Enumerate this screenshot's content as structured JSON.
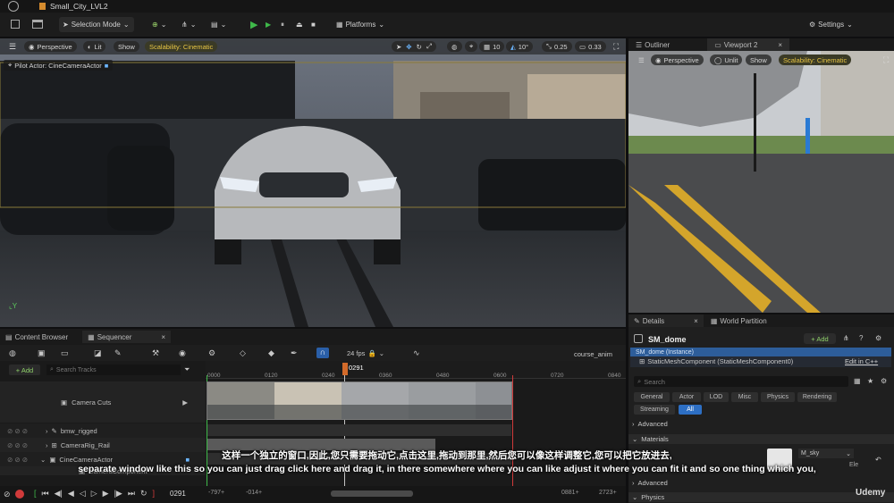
{
  "window": {
    "title": "Small_City_LVL2"
  },
  "toolbar": {
    "selection_mode": "Selection Mode",
    "platforms": "Platforms",
    "settings": "Settings"
  },
  "viewport_left": {
    "perspective": "Perspective",
    "lit": "Lit",
    "show": "Show",
    "scalability": "Scalability: Cinematic",
    "pilot": "Pilot Actor: CineCameraActor",
    "grid_snap": "10",
    "angle_snap": "10°",
    "scale_snap": "0.25",
    "cam_speed": "0.33"
  },
  "right_tabs": {
    "outliner": "Outliner",
    "viewport2": "Viewport 2"
  },
  "viewport_right": {
    "perspective": "Perspective",
    "unlit": "Unlit",
    "show": "Show",
    "scalability": "Scalability: Cinematic"
  },
  "details": {
    "tab": "Details",
    "world_partition": "World Partition",
    "object": "SM_dome",
    "add": "+ Add",
    "instance": "SM_dome (Instance)",
    "component": "StaticMeshComponent (StaticMeshComponent0)",
    "edit_cpp": "Edit in C++",
    "search": "Search",
    "filters": [
      "General",
      "Actor",
      "LOD",
      "Misc",
      "Physics",
      "Rendering",
      "Streaming",
      "All"
    ],
    "sections": [
      "Advanced",
      "Materials",
      "Advanced",
      "Physics"
    ],
    "material": "M_sky",
    "element": "Ele"
  },
  "bottom_tabs": {
    "content_browser": "Content Browser",
    "sequencer": "Sequencer"
  },
  "sequencer": {
    "fps": "24 fps",
    "add": "+ Add",
    "search": "Search Tracks",
    "name": "course_anim",
    "playhead": "0291",
    "ruler": [
      "0000",
      "0120",
      "0240",
      "0360",
      "0480",
      "0600",
      "0720",
      "0840"
    ],
    "tracks": [
      "Camera Cuts",
      "bmw_rigged",
      "CameraRig_Rail",
      "CineCameraActor",
      "CameraComponent"
    ],
    "frame": "0291",
    "start": "-797+",
    "start2": "-014+",
    "end": "0881+",
    "end2": "2723+"
  },
  "subtitles": {
    "zh": "这样一个独立的窗口,因此,您只需要拖动它,点击这里,拖动到那里,然后您可以像这样调整它,您可以把它放进去,",
    "en": "separate window like this so you can just drag click here and drag it, in there somewhere where you can like adjust it where you can fit it and so one thing which you,"
  },
  "watermark": "Udemy",
  "colors": {
    "accent": "#3a83d8",
    "scalability": "#e8c544",
    "record": "#d03a3a",
    "play": "#3fb94a"
  }
}
